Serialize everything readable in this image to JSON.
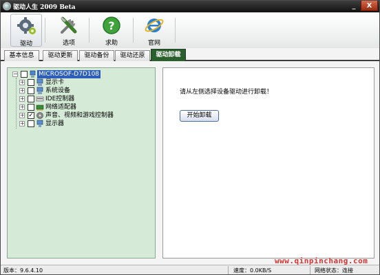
{
  "window": {
    "title": "驱动人生 2009 Beta",
    "minimize_glyph": "_",
    "close_glyph": "X"
  },
  "toolbar": [
    {
      "label": "驱动",
      "icon": "gears-icon"
    },
    {
      "label": "选项",
      "icon": "tools-icon"
    },
    {
      "label": "求助",
      "icon": "help-icon"
    },
    {
      "label": "官网",
      "icon": "ie-icon"
    }
  ],
  "tabs": [
    "基本信息",
    "驱动更新",
    "驱动备份",
    "驱动还原",
    "驱动卸载"
  ],
  "active_tab": "驱动卸载",
  "tree": {
    "root": "MICROSOF-D7D108",
    "items": [
      {
        "label": "显示卡",
        "checked": false,
        "icon": "display-adapter-icon"
      },
      {
        "label": "系统设备",
        "checked": false,
        "icon": "system-device-icon"
      },
      {
        "label": "IDE控制器",
        "checked": false,
        "icon": "ide-controller-icon"
      },
      {
        "label": "网络适配器",
        "checked": false,
        "icon": "network-adapter-icon"
      },
      {
        "label": "声音、视频和游戏控制器",
        "checked": true,
        "icon": "sound-icon"
      },
      {
        "label": "显示器",
        "checked": false,
        "icon": "monitor-icon"
      }
    ]
  },
  "panel": {
    "hint": "请从左侧选择设备驱动进行卸载！",
    "button": "开始卸载"
  },
  "status": {
    "version": "版本：9.6.4.10",
    "speed": "速度：0.0KB/S",
    "network": "网络状态：连接"
  },
  "watermark": "www.qinpinchang.com",
  "colors": {
    "tree_bg": "#d5ead7",
    "active_tab": "#2c5f2e",
    "selection": "#2d5fb8",
    "watermark": "#e03030"
  }
}
